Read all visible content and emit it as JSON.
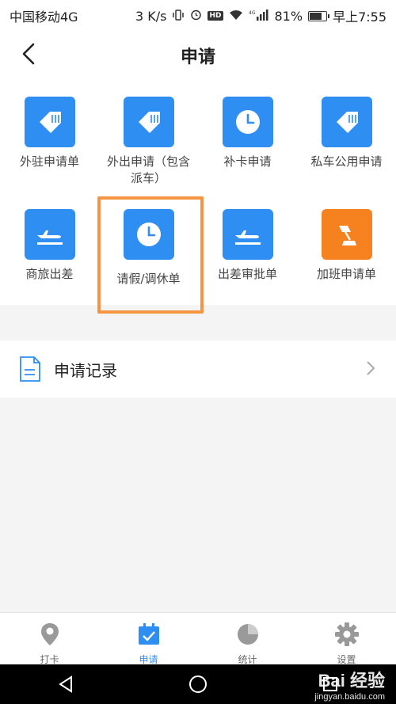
{
  "status_bar": {
    "carrier": "中国移动4G",
    "speed": "3 K/s",
    "hd": "HD",
    "network": "4G",
    "battery": "81%",
    "battery_level": 0.81,
    "time": "早上7:55"
  },
  "header": {
    "title": "申请"
  },
  "apps": [
    {
      "label": "外驻申请单",
      "icon": "tag-icon",
      "color": "#2f8ef2"
    },
    {
      "label": "外出申请（包含派车）",
      "icon": "tag-icon",
      "color": "#2f8ef2"
    },
    {
      "label": "补卡申请",
      "icon": "clock-icon",
      "color": "#2f8ef2"
    },
    {
      "label": "私车公用申请",
      "icon": "tag-icon",
      "color": "#2f8ef2"
    },
    {
      "label": "商旅出差",
      "icon": "plane-icon",
      "color": "#2f8ef2"
    },
    {
      "label": "请假/调休单",
      "icon": "clock-icon",
      "color": "#2f8ef2"
    },
    {
      "label": "出差审批单",
      "icon": "plane-icon",
      "color": "#2f8ef2"
    },
    {
      "label": "加班申请单",
      "icon": "lamp-icon",
      "color": "#f5821f"
    }
  ],
  "records": {
    "label": "申请记录"
  },
  "tabs": [
    {
      "label": "打卡",
      "icon": "location-pin-icon"
    },
    {
      "label": "申请",
      "icon": "calendar-check-icon",
      "active": true
    },
    {
      "label": "统计",
      "icon": "pie-chart-icon"
    },
    {
      "label": "设置",
      "icon": "gear-icon"
    }
  ],
  "watermark": {
    "text": "Bai 经验",
    "sub": "jingyan.baidu.com"
  }
}
